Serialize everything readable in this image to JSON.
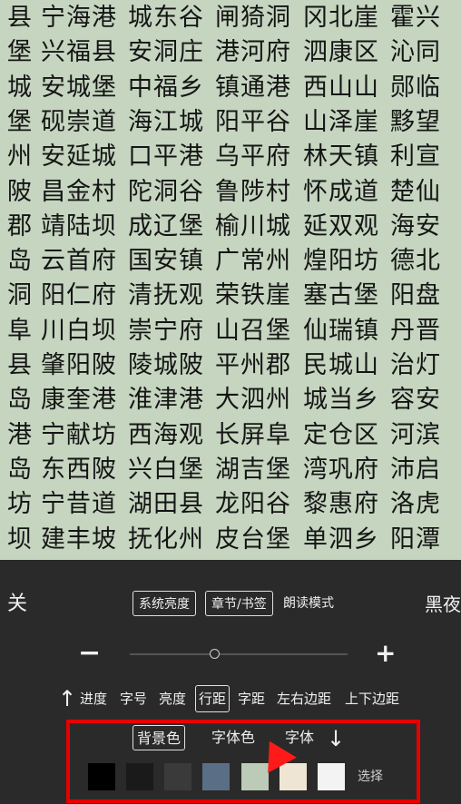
{
  "reader": {
    "rows": [
      [
        "县",
        "宁海港",
        "城东谷",
        "闸猗洞",
        "冈北崖",
        "霍兴"
      ],
      [
        "堡",
        "兴福县",
        "安洞庄",
        "港河府",
        "泗康区",
        "沁同"
      ],
      [
        "城",
        "安城堡",
        "中福乡",
        "镇通港",
        "西山山",
        "郧临"
      ],
      [
        "堡",
        "砚崇道",
        "海江城",
        "阳平谷",
        "山泽崖",
        "黟望"
      ],
      [
        "州",
        "安延城",
        "口平港",
        "乌平府",
        "林天镇",
        "利宣"
      ],
      [
        "陂",
        "昌金村",
        "陀洞谷",
        "鲁陟村",
        "怀成道",
        "楚仙"
      ],
      [
        "郡",
        "靖陆坝",
        "成辽堡",
        "榆川城",
        "延双观",
        "海安"
      ],
      [
        "岛",
        "云首府",
        "国安镇",
        "广常州",
        "煌阳坊",
        "德北"
      ],
      [
        "洞",
        "阳仁府",
        "清抚观",
        "荣铁崖",
        "塞古堡",
        "阳盘"
      ],
      [
        "阜",
        "川白坝",
        "崇宁府",
        "山召堡",
        "仙瑞镇",
        "丹晋"
      ],
      [
        "县",
        "肇阳陂",
        "陵城陂",
        "平州郡",
        "民城山",
        "治灯"
      ],
      [
        "岛",
        "康奎港",
        "淮津港",
        "大泗州",
        "城当乡",
        "容安"
      ],
      [
        "港",
        "宁献坊",
        "西海观",
        "长屏阜",
        "定仓区",
        "河滨"
      ],
      [
        "岛",
        "东西陂",
        "兴白堡",
        "湖吉堡",
        "湾巩府",
        "沛启"
      ],
      [
        "坊",
        "宁昔道",
        "湖田县",
        "龙阳谷",
        "黎惠府",
        "洛虎"
      ],
      [
        "坝",
        "建丰坡",
        "抚化州",
        "皮台堡",
        "单泗乡",
        "阳潭"
      ]
    ]
  },
  "panel": {
    "close_label": "关",
    "system_brightness": "系统亮度",
    "chapter_bookmark": "章节/书签",
    "read_mode": "朗读模式",
    "night_label": "黑夜",
    "minus": "−",
    "plus": "+",
    "arrow_up": "↑",
    "tabs": [
      "进度",
      "字号",
      "亮度",
      "行距",
      "字距",
      "左右边距",
      "上下边距"
    ],
    "active_tab": "行距",
    "sub_tabs": [
      "背景色",
      "字体色",
      "字体"
    ],
    "arrow_down": "↓",
    "swatches": [
      "#000000",
      "#1a1a1a",
      "#3a3a3a",
      "#5a6f86",
      "#bccab8",
      "#efe5d4",
      "#f3f3f3"
    ],
    "choose_label": "选择",
    "accent": "#e60000"
  }
}
